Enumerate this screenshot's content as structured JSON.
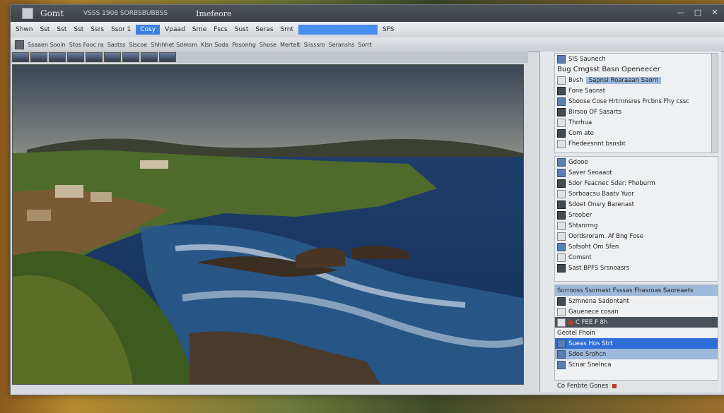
{
  "window": {
    "app_title": "Gomt",
    "subtitle": "VSSS 1908 SORBSBUBBSS",
    "doc_title": "Imefeore",
    "controls": [
      "—",
      "□",
      "✕"
    ]
  },
  "menubar": {
    "items": [
      "Shwn",
      "Sst",
      "Sst",
      "Sst",
      "Ssrs",
      "Ssor 1",
      "Cosy",
      "Vpaad",
      "Srne",
      "Fscs",
      "Sust",
      "Seras",
      "Srnt"
    ],
    "right_label": "SFS"
  },
  "toolbar": {
    "items": [
      "Ssaaen Sooin",
      "Stos Fooc ra",
      "Sastss",
      "Siscoe",
      "Shhhhet Sdmsm",
      "Klsn Soda",
      "Posonhg",
      "Shose",
      "Mertelt",
      "Slisssro",
      "Seranshs",
      "Sorrt"
    ]
  },
  "right_panel": {
    "header": "SIS Saunech",
    "title_row": "Bug Cmgsst Basn Openeecer",
    "search_label": "Bvsh",
    "search_value": "Sapnsi Roaraaan Saorn",
    "list1": [
      "Fone Saonst",
      "Sboose Cose Hrtrnnsres Frcbns Fhy cssc",
      "Blrsoo OF Sasarts",
      "Thrrhua",
      "Com ate",
      "Fhedeesnnt bsosbt"
    ],
    "list2": [
      "Gdooe",
      "Saver Seoaaot",
      "Sdor Feacnec Sder: Phoburm",
      "Sorboacsu Baatv Yuor",
      "Sdoet Onsry Barenast",
      "Sreober",
      "Shtsnrrng",
      "Oordsroram. Af Bng Fose"
    ],
    "list3": [
      "Sofsoht Om Sfen",
      "Comsnt",
      "Sast BPFS Srsnoasrs"
    ],
    "highlight_row": "Sorrooss Ssornast Fsssas Fhasroas Saoreaets",
    "layers": [
      "Szmnena Sadontaht",
      "Gauenece cosan"
    ],
    "dark_row": "C FEE F 8h",
    "layer_header": "Geotel Fhoin",
    "selected_rows": [
      "Sueas Hos Strt",
      "Sdoe Srohcn",
      "Scnar Snelnca"
    ],
    "status": "Co Fenbte Gones"
  },
  "colors": {
    "accent": "#2e6fd7",
    "titlebar": "#42474d",
    "panel": "#e4e7ea"
  }
}
